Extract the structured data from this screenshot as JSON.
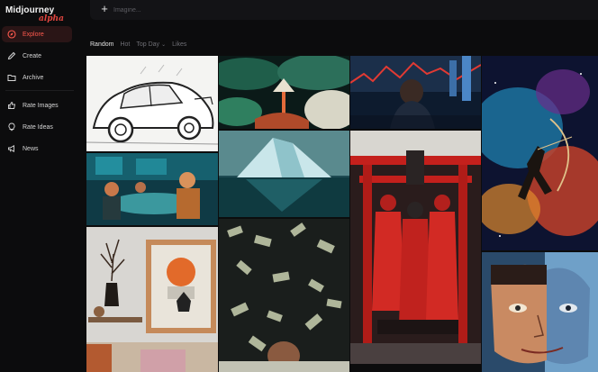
{
  "brand": {
    "name": "Midjourney",
    "tag": "alpha"
  },
  "nav": [
    {
      "label": "Explore",
      "icon": "compass-icon",
      "active": true
    },
    {
      "label": "Create",
      "icon": "pencil-icon"
    },
    {
      "label": "Archive",
      "icon": "folder-icon"
    },
    {
      "label": "Rate Images",
      "icon": "thumbs-up-icon"
    },
    {
      "label": "Rate Ideas",
      "icon": "lightbulb-icon"
    },
    {
      "label": "News",
      "icon": "megaphone-icon"
    }
  ],
  "prompt": {
    "placeholder": "Imagine..."
  },
  "filters": [
    {
      "label": "Random",
      "active": true
    },
    {
      "label": "Hot"
    },
    {
      "label": "Top Day",
      "dropdown": true
    },
    {
      "label": "Likes"
    }
  ],
  "colors": {
    "accent": "#ff5a4e",
    "background": "#0c0c0d"
  },
  "gallery": [
    {
      "subject": "car-sketch"
    },
    {
      "subject": "storm-clouds"
    },
    {
      "subject": "city-figure"
    },
    {
      "subject": "archer-nebula"
    },
    {
      "subject": "restaurant-scene"
    },
    {
      "subject": "iceberg"
    },
    {
      "subject": "red-torii-trio"
    },
    {
      "subject": "interior-poster"
    },
    {
      "subject": "money-rain"
    },
    {
      "subject": "cubist-face"
    }
  ]
}
